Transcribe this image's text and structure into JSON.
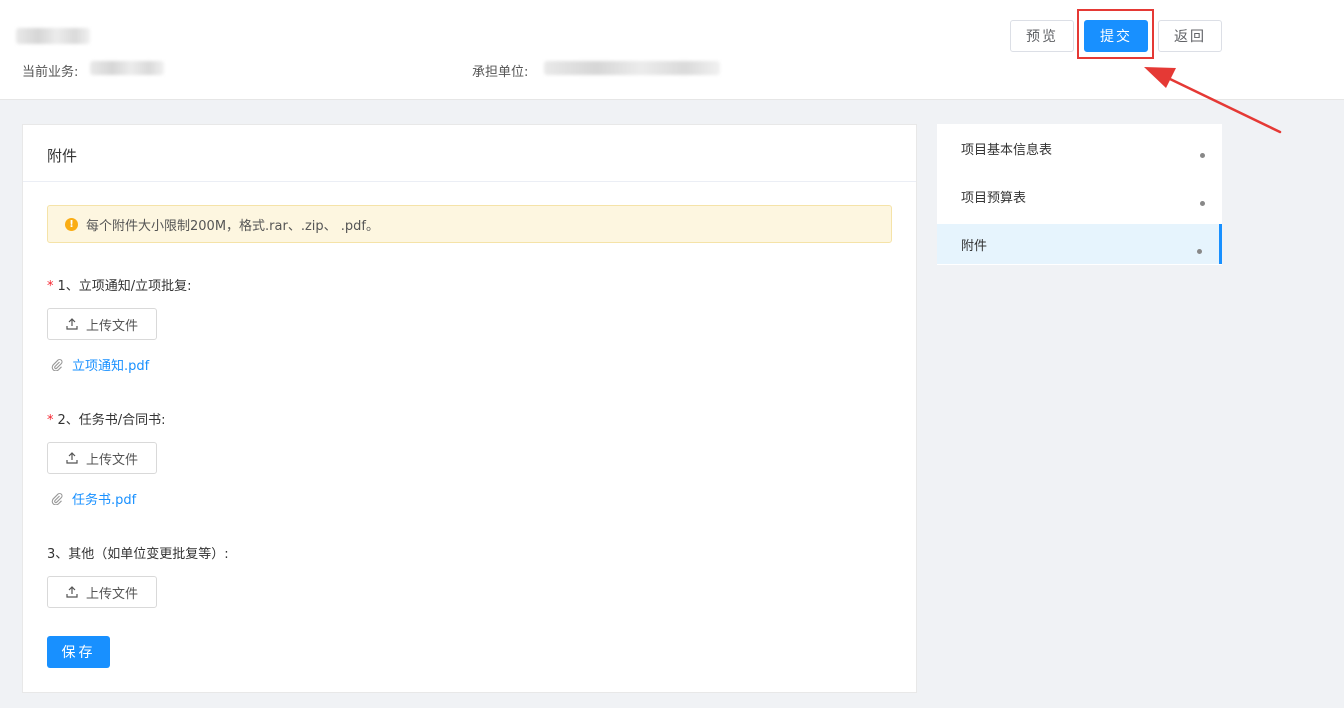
{
  "header": {
    "current_business_label": "当前业务:",
    "undertaking_unit_label": "承担单位:",
    "preview_label": "预览",
    "submit_label": "提交",
    "back_label": "返回"
  },
  "attachments": {
    "title": "附件",
    "notice": "每个附件大小限制200M，格式.rar、.zip、 .pdf。",
    "required_mark": "*",
    "fields": [
      {
        "label": "1、立项通知/立项批复:",
        "upload_label": "上传文件",
        "file": "立项通知.pdf"
      },
      {
        "label": "2、任务书/合同书:",
        "upload_label": "上传文件",
        "file": "任务书.pdf"
      },
      {
        "label": "3、其他（如单位变更批复等）:",
        "upload_label": "上传文件"
      }
    ],
    "save_label": "保存"
  },
  "sidenav": {
    "items": [
      {
        "label": "项目基本信息表"
      },
      {
        "label": "项目预算表"
      },
      {
        "label": "附件"
      }
    ]
  },
  "colors": {
    "primary": "#1890ff",
    "highlight": "#e53935",
    "warning": "#faad14"
  }
}
